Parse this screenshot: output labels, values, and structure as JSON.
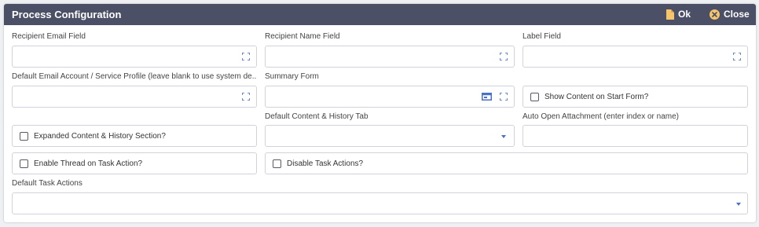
{
  "dialog": {
    "title": "Process Configuration",
    "ok_label": "Ok",
    "close_label": "Close"
  },
  "fields": {
    "recipient_email": {
      "label": "Recipient Email Field",
      "value": ""
    },
    "recipient_name": {
      "label": "Recipient Name Field",
      "value": ""
    },
    "label_field": {
      "label": "Label Field",
      "value": ""
    },
    "default_email_account": {
      "label": "Default Email Account / Service Profile (leave blank to use system de...",
      "value": ""
    },
    "summary_form": {
      "label": "Summary Form",
      "value": ""
    },
    "show_content": {
      "label": "Show Content on Start Form?",
      "checked": false
    },
    "expanded_content": {
      "label": "Expanded Content & History Section?",
      "checked": false
    },
    "default_content_tab": {
      "label": "Default Content & History Tab",
      "value": ""
    },
    "auto_open_attachment": {
      "label": "Auto Open Attachment (enter index or name)",
      "value": ""
    },
    "enable_thread": {
      "label": "Enable Thread on Task Action?",
      "checked": false
    },
    "disable_task_actions": {
      "label": "Disable Task Actions?",
      "checked": false
    },
    "default_task_actions": {
      "label": "Default Task Actions",
      "value": ""
    }
  },
  "colors": {
    "titlebar": "#4b5066",
    "icon_blue": "#4a72c4",
    "ok_icon": "#f5c46b",
    "close_icon": "#f5c46b"
  },
  "icons": {
    "expand": "expand-icon",
    "form": "form-icon",
    "ok": "document-icon",
    "close": "close-circle-icon",
    "dropdown": "chevron-down-icon"
  }
}
